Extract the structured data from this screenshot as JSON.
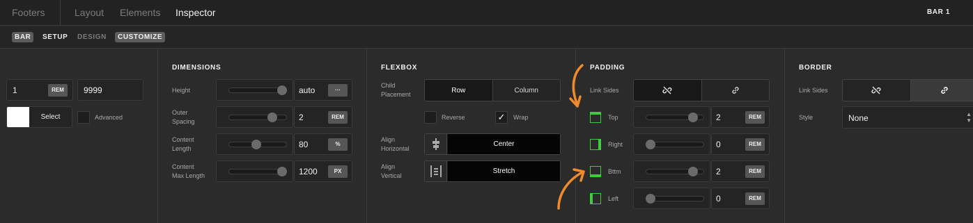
{
  "topbar": {
    "tabs": [
      {
        "label": "Footers",
        "active": false
      },
      {
        "label": "Layout",
        "active": false
      },
      {
        "label": "Elements",
        "active": false
      },
      {
        "label": "Inspector",
        "active": true
      }
    ],
    "element_name": "BAR 1"
  },
  "subbar": {
    "type_label": "BAR",
    "tabs": [
      {
        "label": "SETUP",
        "active": true
      },
      {
        "label": "DESIGN",
        "active": false
      },
      {
        "label": "CUSTOMIZE",
        "active": false
      }
    ]
  },
  "left_panel": {
    "value_a": "1",
    "unit_a": "REM",
    "value_b": "9999",
    "select_label": "Select",
    "advanced_label": "Advanced"
  },
  "dimensions": {
    "title": "DIMENSIONS",
    "rows": [
      {
        "label": "Height",
        "value": "auto",
        "unit": "···",
        "level": 1.0
      },
      {
        "label": "Outer\nSpacing",
        "value": "2",
        "unit": "REM",
        "level": 0.8
      },
      {
        "label": "Content\nLength",
        "value": "80",
        "unit": "%",
        "level": 0.47
      },
      {
        "label": "Content\nMax Length",
        "value": "1200",
        "unit": "PX",
        "level": 1.0
      }
    ]
  },
  "flexbox": {
    "title": "FLEXBOX",
    "child_placement_label": "Child\nPlacement",
    "placement_options": [
      "Row",
      "Column"
    ],
    "placement_selected": "Row",
    "reverse_label": "Reverse",
    "reverse_checked": false,
    "wrap_label": "Wrap",
    "wrap_checked": true,
    "align_horizontal_label": "Align\nHorizontal",
    "align_horizontal_value": "Center",
    "align_vertical_label": "Align\nVertical",
    "align_vertical_value": "Stretch"
  },
  "padding": {
    "title": "PADDING",
    "link_sides_label": "Link Sides",
    "sides": [
      {
        "label": "Top",
        "value": "2",
        "unit": "REM",
        "level": 0.87
      },
      {
        "label": "Right",
        "value": "0",
        "unit": "REM",
        "level": 0.0
      },
      {
        "label": "Bttm",
        "value": "2",
        "unit": "REM",
        "level": 0.87
      },
      {
        "label": "Left",
        "value": "0",
        "unit": "REM",
        "level": 0.0
      }
    ]
  },
  "border": {
    "title": "BORDER",
    "link_sides_label": "Link Sides",
    "style_label": "Style",
    "style_value": "None"
  },
  "colors": {
    "accent_green": "#3ccc3c",
    "annotation_orange": "#f08a2a"
  }
}
